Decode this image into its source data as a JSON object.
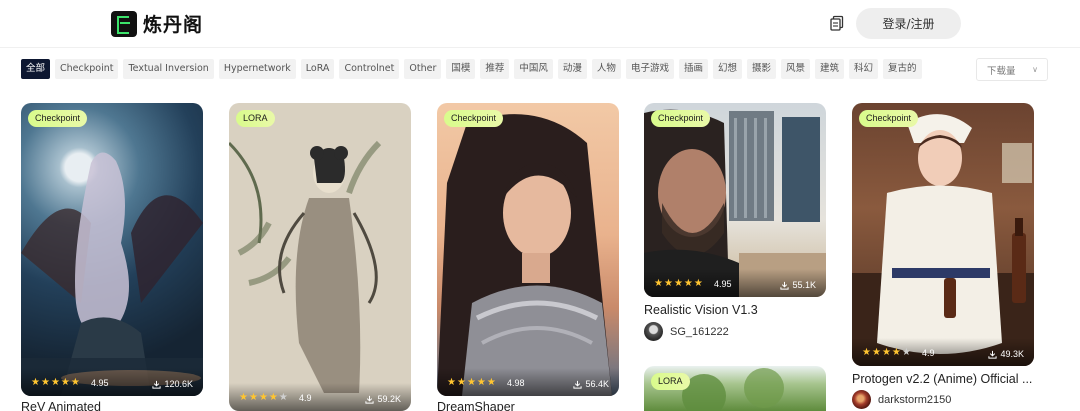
{
  "brand": {
    "name": "炼丹阁"
  },
  "header": {
    "login_label": "登录/注册"
  },
  "filters": [
    "全部",
    "Checkpoint",
    "Textual Inversion",
    "Hypernetwork",
    "LoRA",
    "Controlnet",
    "Other",
    "国模",
    "推荐",
    "中国风",
    "动漫",
    "人物",
    "电子游戏",
    "插画",
    "幻想",
    "摄影",
    "风景",
    "建筑",
    "科幻",
    "复古的"
  ],
  "active_filter": "全部",
  "sort": {
    "selected": "下载量"
  },
  "colors": {
    "accent_active": "#0d1731",
    "badge_start": "#d9fb8c",
    "star": "#ffc531"
  },
  "cards": [
    {
      "badge": "Checkpoint",
      "rating": "4.95",
      "stars": 5,
      "downloads": "120.6K",
      "title": "ReV Animated"
    },
    {
      "badge": "LORA",
      "rating": "4.9",
      "stars": 4,
      "downloads": "59.2K",
      "title": ""
    },
    {
      "badge": "Checkpoint",
      "rating": "4.98",
      "stars": 5,
      "downloads": "56.4K",
      "title": "DreamShaper"
    },
    {
      "badge": "Checkpoint",
      "rating": "4.95",
      "stars": 5,
      "downloads": "55.1K",
      "title": "Realistic Vision V1.3",
      "author": "SG_161222"
    },
    {
      "badge": "Checkpoint",
      "rating": "4.9",
      "stars": 4,
      "downloads": "49.3K",
      "title": "Protogen v2.2 (Anime) Official ...",
      "author": "darkstorm2150"
    },
    {
      "badge": "LORA"
    }
  ],
  "icons": {
    "copy": "copy-icon",
    "download": "download-icon",
    "star": "star-icon",
    "chevron": "chevron-down-icon"
  }
}
